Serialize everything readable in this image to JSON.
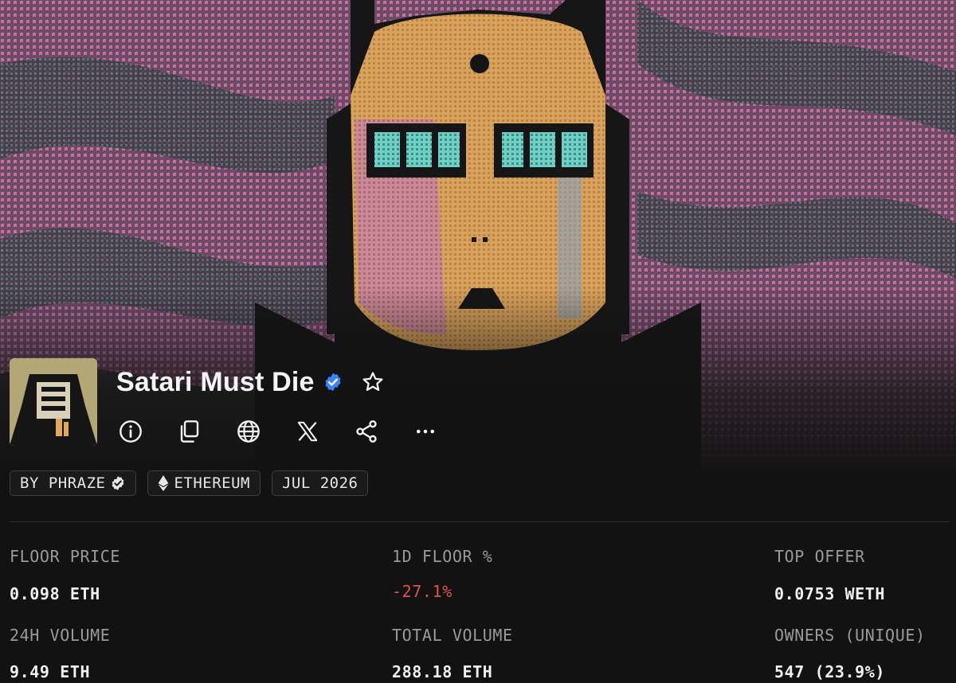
{
  "collection": {
    "name": "Satari Must Die",
    "verified_icon": "verified-badge-icon",
    "favorite_icon": "star-outline-icon"
  },
  "actions": [
    {
      "name": "info",
      "icon": "info-icon"
    },
    {
      "name": "copy",
      "icon": "copy-icon"
    },
    {
      "name": "website",
      "icon": "globe-icon"
    },
    {
      "name": "x-profile",
      "icon": "x-logo-icon"
    },
    {
      "name": "share",
      "icon": "share-icon"
    },
    {
      "name": "more",
      "icon": "more-horizontal-icon"
    }
  ],
  "chips": {
    "creator": "BY PHRAZE",
    "chain": "ETHEREUM",
    "date": "JUL 2026"
  },
  "stats": {
    "floor_price": {
      "label": "FLOOR PRICE",
      "value": "0.098 ETH"
    },
    "floor_change": {
      "label": "1D FLOOR %",
      "value": "-27.1%"
    },
    "top_offer": {
      "label": "TOP OFFER",
      "value": "0.0753 WETH"
    },
    "volume_24h": {
      "label": "24H VOLUME",
      "value": "9.49 ETH"
    },
    "total_volume": {
      "label": "TOTAL VOLUME",
      "value": "288.18 ETH"
    },
    "owners": {
      "label": "OWNERS (UNIQUE)",
      "value": "547 (23.9%)"
    }
  },
  "colors": {
    "background": "#121212",
    "negative": "#e0524f",
    "verified": "#3b82f6",
    "banner_pink": "#b8628f",
    "banner_orange": "#e0a85a",
    "banner_teal": "#5ec5bd"
  }
}
